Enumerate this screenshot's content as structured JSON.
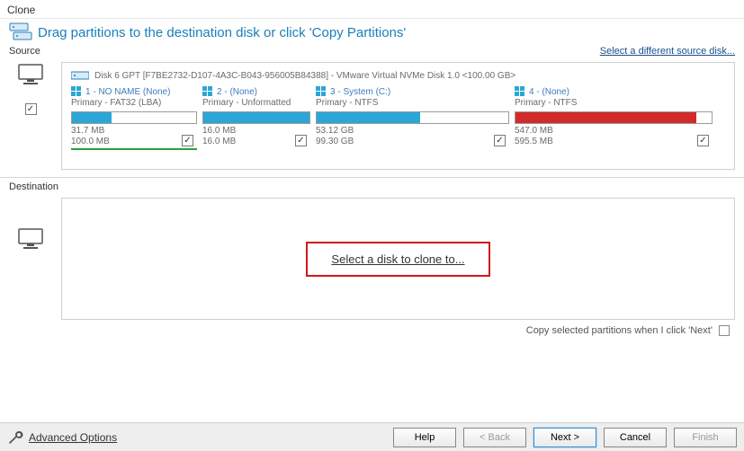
{
  "window": {
    "title": "Clone"
  },
  "header": {
    "instruction": "Drag partitions to the destination disk or click 'Copy Partitions'"
  },
  "source": {
    "label": "Source",
    "change_link": "Select a different source disk...",
    "disk_header": "Disk 6 GPT [F7BE2732-D107-4A3C-B043-956005B84388] - VMware Virtual NVMe Disk 1.0  <100.00 GB>",
    "partitions": [
      {
        "title": "1 - NO NAME (None)",
        "subtitle": "Primary - FAT32 (LBA)",
        "used": "31.7 MB",
        "total": "100.0 MB",
        "fillPct": 32,
        "color": "blue",
        "checked": true,
        "selected": true
      },
      {
        "title": "2 -  (None)",
        "subtitle": "Primary - Unformatted",
        "used": "16.0 MB",
        "total": "16.0 MB",
        "fillPct": 100,
        "color": "blue",
        "checked": true,
        "selected": false
      },
      {
        "title": "3 - System (C:)",
        "subtitle": "Primary - NTFS",
        "used": "53.12 GB",
        "total": "99.30 GB",
        "fillPct": 54,
        "color": "blue",
        "checked": true,
        "selected": false
      },
      {
        "title": "4 -  (None)",
        "subtitle": "Primary - NTFS",
        "used": "547.0 MB",
        "total": "595.5 MB",
        "fillPct": 92,
        "color": "red",
        "checked": true,
        "selected": false
      }
    ]
  },
  "destination": {
    "label": "Destination",
    "cta": "Select a disk to clone to...",
    "copy_on_next": "Copy selected partitions when I click 'Next'",
    "copy_checked": false
  },
  "footer": {
    "advanced": "Advanced Options",
    "help": "Help",
    "back": "< Back",
    "next": "Next >",
    "cancel": "Cancel",
    "finish": "Finish"
  },
  "partition_widths": [
    140,
    120,
    215,
    220
  ]
}
